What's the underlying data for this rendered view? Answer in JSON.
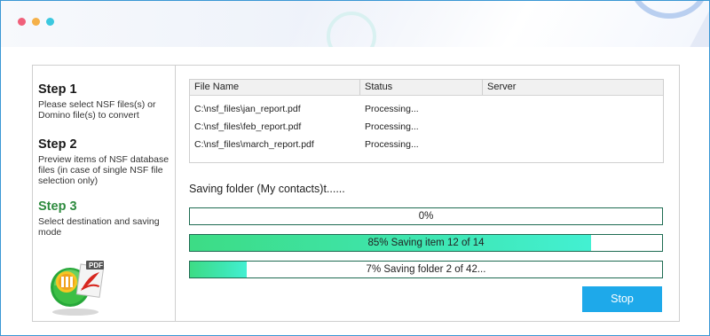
{
  "window": {
    "dots": [
      "red",
      "yellow",
      "cyan"
    ],
    "accent": "#3a97d4"
  },
  "sidebar": {
    "steps": [
      {
        "title": "Step 1",
        "desc": "Please select NSF files(s) or Domino file(s) to convert",
        "active": false
      },
      {
        "title": "Step 2",
        "desc": "Preview items of NSF database files (in case of single NSF file selection only)",
        "active": false
      },
      {
        "title": "Step 3",
        "desc": "Select destination and saving mode",
        "active": true
      }
    ],
    "logo_icon": "nsf-to-pdf-logo-icon",
    "logo_text": "PDF"
  },
  "table": {
    "headers": [
      "File Name",
      "Status",
      "Server"
    ],
    "rows": [
      {
        "file": "C:\\nsf_files\\jan_report.pdf",
        "status": "Processing...",
        "server": ""
      },
      {
        "file": "C:\\nsf_files\\feb_report.pdf",
        "status": "Processing...",
        "server": ""
      },
      {
        "file": "C:\\nsf_files\\march_report.pdf",
        "status": "Processing...",
        "server": ""
      }
    ]
  },
  "saving_label": "Saving folder (My contacts)t......",
  "progress": [
    {
      "text": "0%",
      "value": 0
    },
    {
      "text": "85% Saving item 12 of 14",
      "value": 0.85
    },
    {
      "text": "7% Saving folder 2 of 42...",
      "value": 0.12
    }
  ],
  "stop_label": "Stop",
  "colors": {
    "step_active": "#2e8b3f",
    "progress_fill": "#3ee6b2",
    "stop_button": "#1ea9ea"
  }
}
